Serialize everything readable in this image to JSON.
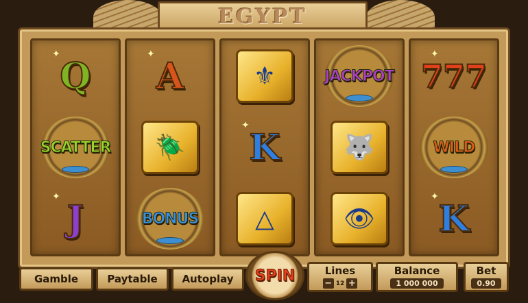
{
  "title": "EGYPT",
  "reels": [
    [
      {
        "kind": "letter",
        "text": "Q",
        "color": "#7fb524",
        "name": "symbol-q"
      },
      {
        "kind": "badge",
        "text": "SCATTER",
        "color": "#9ad12c",
        "name": "symbol-scatter"
      },
      {
        "kind": "letter",
        "text": "J",
        "color": "#8f3fd0",
        "name": "symbol-j"
      }
    ],
    [
      {
        "kind": "letter",
        "text": "A",
        "color": "#d8541c",
        "name": "symbol-a"
      },
      {
        "kind": "tile",
        "icon": "scarab-icon",
        "glyph": "🪲",
        "name": "symbol-scarab"
      },
      {
        "kind": "badge",
        "text": "BONUS",
        "color": "#3b8fe0",
        "name": "symbol-bonus"
      }
    ],
    [
      {
        "kind": "tile",
        "icon": "lotus-icon",
        "glyph": "⚜",
        "name": "symbol-lotus"
      },
      {
        "kind": "letter",
        "text": "K",
        "color": "#2f7fe0",
        "name": "symbol-k"
      },
      {
        "kind": "tile",
        "icon": "pyramid-icon",
        "glyph": "△",
        "name": "symbol-pyramid"
      }
    ],
    [
      {
        "kind": "badge",
        "text": "JACKPOT",
        "color": "#b03ec8",
        "name": "symbol-jackpot"
      },
      {
        "kind": "tile",
        "icon": "anubis-icon",
        "glyph": "🐺",
        "name": "symbol-anubis"
      },
      {
        "kind": "tile",
        "icon": "eye-of-horus-icon",
        "glyph": "👁",
        "name": "symbol-eye"
      }
    ],
    [
      {
        "kind": "letter",
        "text": "777",
        "color": "#e0401a",
        "name": "symbol-777"
      },
      {
        "kind": "badge",
        "text": "WILD",
        "color": "#e05a1a",
        "name": "symbol-wild"
      },
      {
        "kind": "letter",
        "text": "K",
        "color": "#2f7fe0",
        "name": "symbol-k"
      }
    ]
  ],
  "controls": {
    "gamble": "Gamble",
    "paytable": "Paytable",
    "autoplay": "Autoplay",
    "spin": "SPIN",
    "lines_label": "Lines",
    "lines_value": "12",
    "minus": "−",
    "plus": "+",
    "balance_label": "Balance",
    "balance_value": "1 000 000",
    "bet_label": "Bet",
    "bet_value": "0.90"
  }
}
